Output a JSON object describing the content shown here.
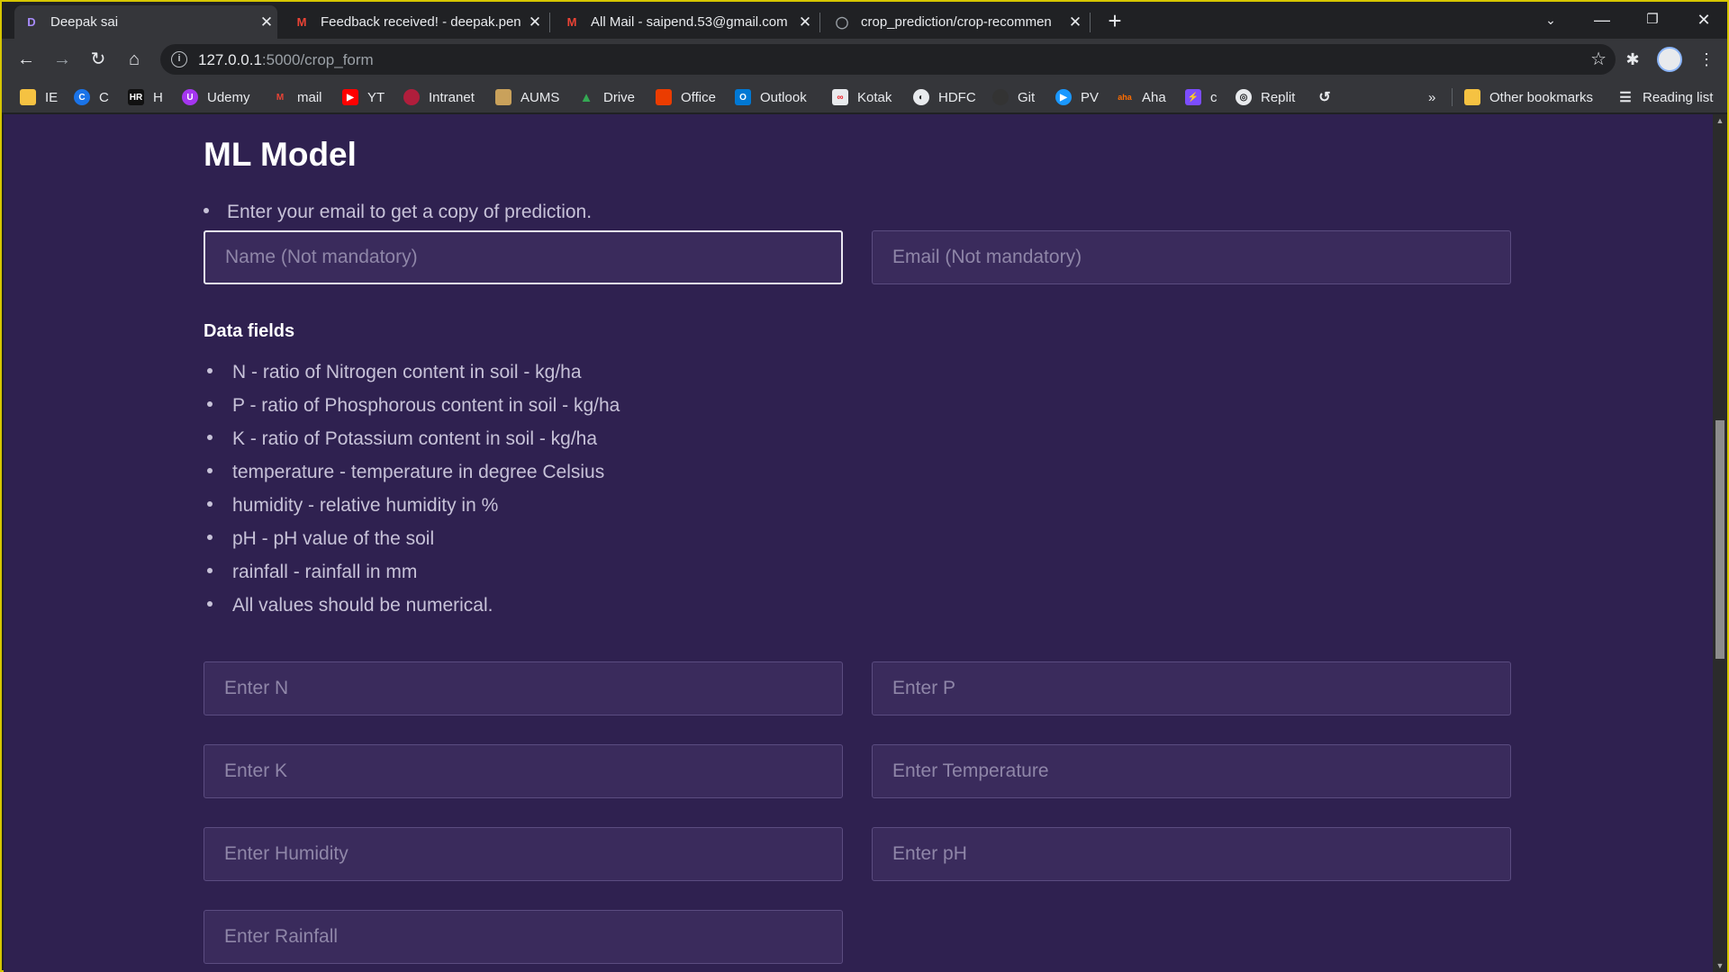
{
  "browser": {
    "tabs": [
      {
        "title": "Deepak sai",
        "favicon": "D",
        "active": true
      },
      {
        "title": "Feedback received! - deepak.pen",
        "favicon": "M",
        "active": false
      },
      {
        "title": "All Mail - saipend.53@gmail.com",
        "favicon": "M",
        "active": false
      },
      {
        "title": "crop_prediction/crop-recommen",
        "favicon": "github-icon",
        "active": false
      }
    ],
    "url_host": "127.0.0.1",
    "url_path": ":5000/crop_form",
    "bookmarks": [
      {
        "label": "IE",
        "icon": "folder-icon",
        "color": "#f5c242"
      },
      {
        "label": "C",
        "icon": "c-icon",
        "color": "#1a73e8"
      },
      {
        "label": "H",
        "icon": "hackerrank-icon",
        "color": "#111111"
      },
      {
        "label": "Udemy",
        "icon": "udemy-icon",
        "color": "#a435f0"
      },
      {
        "label": "mail",
        "icon": "gmail-icon",
        "color": "#ea4335"
      },
      {
        "label": "YT",
        "icon": "youtube-icon",
        "color": "#ff0000"
      },
      {
        "label": "Intranet",
        "icon": "intranet-icon",
        "color": "#b01e3c"
      },
      {
        "label": "AUMS",
        "icon": "aums-icon",
        "color": "#c9a15b"
      },
      {
        "label": "Drive",
        "icon": "drive-icon",
        "color": "#34a853"
      },
      {
        "label": "Office",
        "icon": "office-icon",
        "color": "#eb3c00"
      },
      {
        "label": "Outlook",
        "icon": "outlook-icon",
        "color": "#0078d4"
      },
      {
        "label": "Kotak",
        "icon": "kotak-icon",
        "color": "#ed1c24"
      },
      {
        "label": "HDFC",
        "icon": "globe-icon",
        "color": "#e8eaed"
      },
      {
        "label": "Git",
        "icon": "github-icon",
        "color": "#333333"
      },
      {
        "label": "PV",
        "icon": "primevideo-icon",
        "color": "#1a98ff"
      },
      {
        "label": "Aha",
        "icon": "aha-icon",
        "color": "#ff6d00"
      },
      {
        "label": "c",
        "icon": "bolt-icon",
        "color": "#7c4dff"
      },
      {
        "label": "Replit",
        "icon": "replit-icon",
        "color": "#e8eaed"
      }
    ],
    "more_bookmarks": "»",
    "other_bookmarks": "Other bookmarks",
    "reading_list": "Reading list"
  },
  "page": {
    "title": "ML Model",
    "email_note": "Enter your email to get a copy of prediction.",
    "name_placeholder": "Name (Not mandatory)",
    "email_placeholder": "Email (Not mandatory)",
    "data_fields_heading": "Data fields",
    "data_fields": [
      "N - ratio of Nitrogen content in soil - kg/ha",
      "P - ratio of Phosphorous content in soil - kg/ha",
      "K - ratio of Potassium content in soil - kg/ha",
      "temperature - temperature in degree Celsius",
      "humidity - relative humidity in %",
      "pH - pH value of the soil",
      "rainfall - rainfall in mm",
      "All values should be numerical."
    ],
    "inputs": {
      "n": "Enter N",
      "p": "Enter P",
      "k": "Enter K",
      "temperature": "Enter Temperature",
      "humidity": "Enter Humidity",
      "ph": "Enter pH",
      "rainfall": "Enter Rainfall"
    }
  }
}
